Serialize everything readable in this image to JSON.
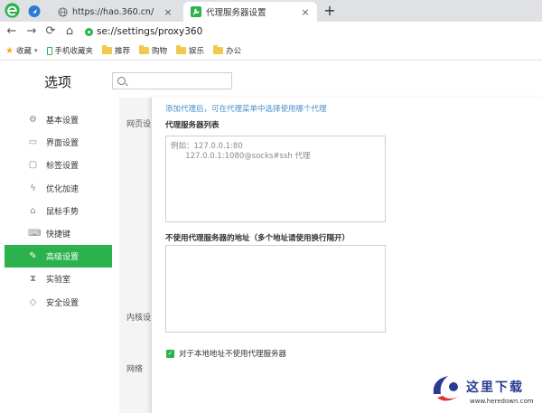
{
  "browser": {
    "tabs": [
      {
        "title": "https://hao.360.cn/",
        "active": false
      },
      {
        "title": "代理服务器设置",
        "active": true
      }
    ],
    "new_tab_symbol": "+",
    "close_symbol": "×",
    "address": "se://settings/proxy360"
  },
  "bookmarks": [
    {
      "label": "收藏",
      "icon": "star-icon"
    },
    {
      "label": "手机收藏夹",
      "icon": "phone-icon"
    },
    {
      "label": "推荐",
      "icon": "folder-icon"
    },
    {
      "label": "购物",
      "icon": "folder-icon"
    },
    {
      "label": "娱乐",
      "icon": "folder-icon"
    },
    {
      "label": "办公",
      "icon": "folder-icon"
    }
  ],
  "settings": {
    "title": "选项",
    "search_placeholder": "",
    "sidebar": [
      {
        "label": "基本设置",
        "icon": "gear-icon"
      },
      {
        "label": "界面设置",
        "icon": "window-icon"
      },
      {
        "label": "标签设置",
        "icon": "tab-icon"
      },
      {
        "label": "优化加速",
        "icon": "lightning-icon"
      },
      {
        "label": "鼠标手势",
        "icon": "mouse-icon"
      },
      {
        "label": "快捷键",
        "icon": "keyboard-icon"
      },
      {
        "label": "高级设置",
        "icon": "wrench-icon",
        "active": true
      },
      {
        "label": "实验室",
        "icon": "flask-icon"
      },
      {
        "label": "安全设置",
        "icon": "shield-icon"
      }
    ],
    "section_labels": [
      "网页设",
      "内核设",
      "网络"
    ]
  },
  "proxy_dialog": {
    "hint": "添加代理后，可在代理菜单中选择使用哪个代理",
    "list_label": "代理服务器列表",
    "list_placeholder": "例如：127.0.0.1:80\n      127.0.0.1:1080@socks#ssh 代理",
    "bypass_label": "不使用代理服务器的地址（多个地址请使用换行隔开）",
    "bypass_value": "",
    "local_bypass_label": "对于本地地址不使用代理服务器",
    "local_bypass_checked": true
  },
  "watermark": {
    "title": "这里下载",
    "url": "www.heredown.com"
  },
  "colors": {
    "accent": "#2bb24c",
    "hint_blue": "#4a90c9",
    "tabstrip": "#dfe1e5"
  }
}
